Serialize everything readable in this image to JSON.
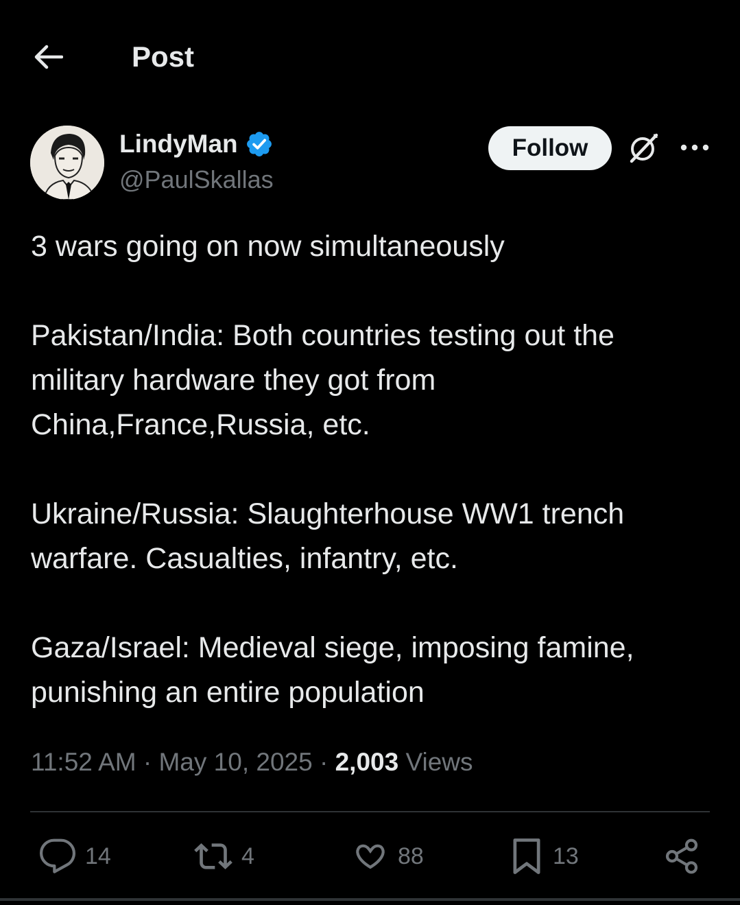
{
  "header": {
    "title": "Post"
  },
  "author": {
    "display_name": "LindyMan",
    "handle": "@PaulSkallas",
    "verified": true,
    "follow_label": "Follow"
  },
  "tweet": {
    "paragraphs": [
      [
        "3 wars going on now simultaneously"
      ],
      [
        "Pakistan/India: Both countries testing out the",
        "military hardware they got from",
        "China,France,Russia, etc."
      ],
      [
        "Ukraine/Russia: Slaughterhouse WW1 trench",
        "warfare. Casualties, infantry, etc."
      ],
      [
        "Gaza/Israel: Medieval siege, imposing famine,",
        "punishing an entire population"
      ]
    ]
  },
  "meta": {
    "time": "11:52 AM",
    "separator": "·",
    "date": "May 10, 2025",
    "views_count": "2,003",
    "views_label": "Views"
  },
  "actions": {
    "replies": "14",
    "reposts": "4",
    "likes": "88",
    "bookmarks": "13"
  },
  "colors": {
    "background": "#000000",
    "primary_text": "#e7e9ea",
    "secondary_text": "#71767b",
    "verified_blue": "#1d9bf0",
    "follow_bg": "#eff3f4"
  },
  "icons": {
    "back": "arrow-left-icon",
    "verified": "verified-badge-icon",
    "grok": "grok-icon",
    "more": "more-icon",
    "reply": "reply-icon",
    "repost": "repost-icon",
    "like": "heart-icon",
    "bookmark": "bookmark-icon",
    "share": "share-icon"
  }
}
